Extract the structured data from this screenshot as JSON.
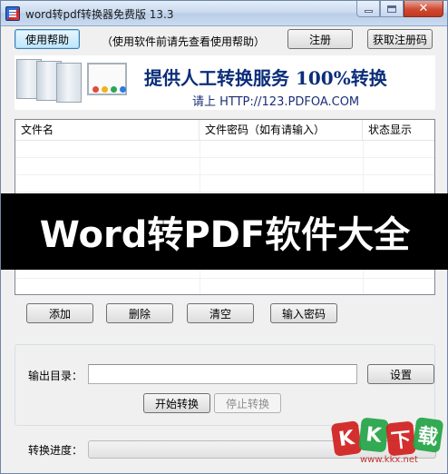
{
  "window": {
    "title": "word转pdf转换器免费版 13.3"
  },
  "toolbar": {
    "help_label": "使用帮助",
    "hint": "（使用软件前请先查看使用帮助）",
    "register_label": "注册",
    "get_code_label": "获取注册码"
  },
  "banner": {
    "headline": "提供人工转换服务 100%转换",
    "url_line": "请上   HTTP://123.PDFOA.COM"
  },
  "table": {
    "columns": [
      "文件名",
      "文件密码（如有请输入）",
      "状态显示"
    ]
  },
  "overlay": {
    "text": "Word转PDF软件大全"
  },
  "actions": {
    "add": "添加",
    "delete": "删除",
    "clear": "清空",
    "password": "输入密码"
  },
  "output": {
    "label": "输出目录：",
    "value": "",
    "settings_label": "设置",
    "start_label": "开始转换",
    "stop_label": "停止转换"
  },
  "progress": {
    "label": "转换进度：",
    "value": 0
  },
  "watermark": {
    "letters": [
      "K",
      "K",
      "下",
      "载"
    ],
    "url": "www.kkx.net"
  },
  "colors": {
    "accent": "#3c7fb1",
    "banner_text": "#0b2e7a",
    "watermark_red": "#d21f1f",
    "watermark_green": "#23a546"
  }
}
